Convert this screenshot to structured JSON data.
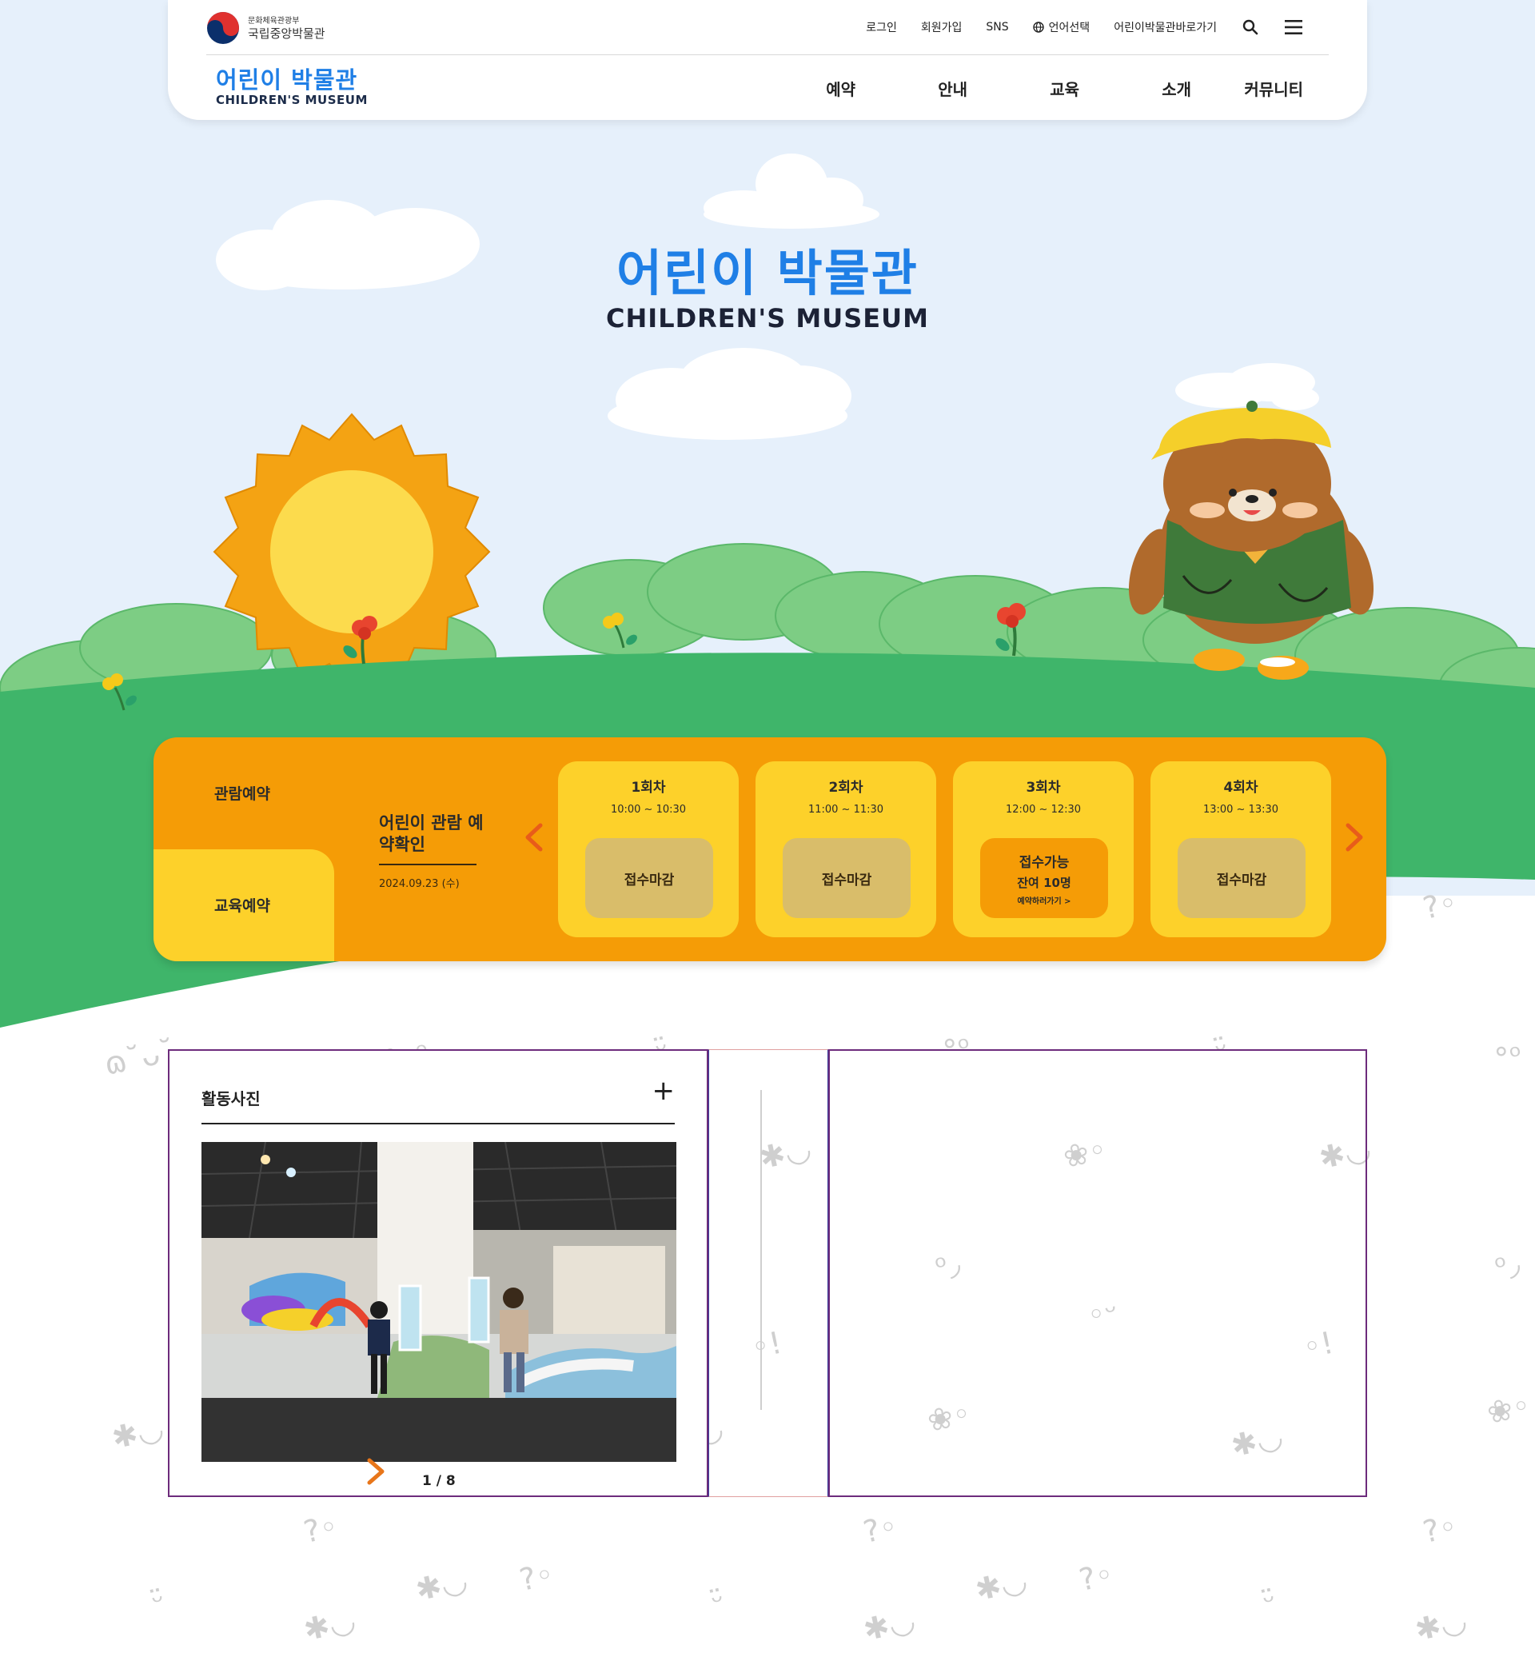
{
  "gov": {
    "ministry": "문화체육관광부",
    "museum": "국립중앙박물관"
  },
  "top_links": {
    "login": "로그인",
    "signup": "회원가입",
    "sns": "SNS",
    "language": "언어선택",
    "shortcut": "어린이박물관바로가기"
  },
  "sub_logo": {
    "ko": "어린이 박물관",
    "en": "CHILDREN'S MUSEUM"
  },
  "main_nav": [
    "예약",
    "안내",
    "교육",
    "소개",
    "커뮤니티"
  ],
  "hero": {
    "title_ko": "어린이 박물관",
    "title_en": "CHILDREN'S MUSEUM"
  },
  "reservation": {
    "tab_view": "관람예약",
    "tab_edu": "교육예약",
    "check_title": "어린이 관람 예약확인",
    "date": "2024.09.23 (수)",
    "sessions": [
      {
        "name": "1회차",
        "time": "10:00 ~ 10:30",
        "status": "접수마감"
      },
      {
        "name": "2회차",
        "time": "11:00 ~ 11:30",
        "status": "접수마감"
      },
      {
        "name": "3회차",
        "time": "12:00 ~ 12:30",
        "status": "접수가능",
        "remaining": "잔여 10명",
        "link": "예약하러가기 >"
      },
      {
        "name": "4회차",
        "time": "13:00 ~ 13:30",
        "status": "접수마감"
      }
    ]
  },
  "photos": {
    "heading": "활동사진",
    "more": "+",
    "pager": "1 / 8"
  },
  "colors": {
    "sky": "#e6f0fb",
    "grass": "#3fb56a",
    "bush": "#7dcd84",
    "panel_orange": "#f59c06",
    "panel_yellow": "#fdd12a",
    "brand_blue": "#1f7fe6",
    "card_border": "#6d2c7c"
  }
}
